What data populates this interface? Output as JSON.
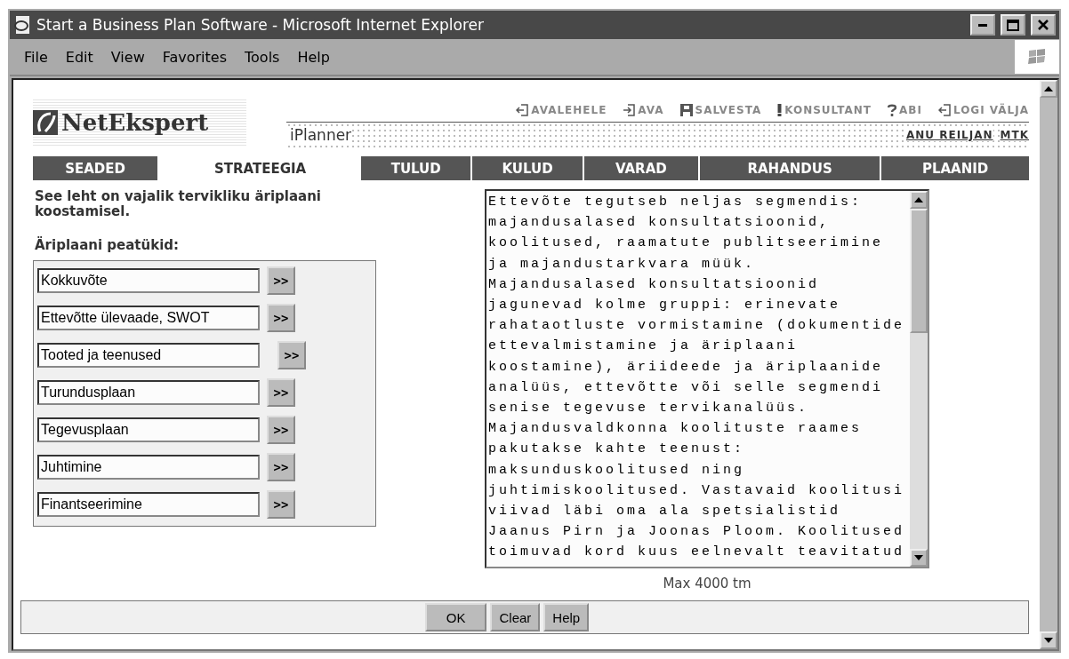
{
  "window": {
    "title": "Start a Business Plan Software - Microsoft Internet Explorer"
  },
  "menu": [
    "File",
    "Edit",
    "View",
    "Favorites",
    "Tools",
    "Help"
  ],
  "logo": "NetEkspert",
  "app_name": "iPlanner",
  "top_links": [
    {
      "kind": "home",
      "label": "AVALEHELE"
    },
    {
      "kind": "open",
      "label": "AVA"
    },
    {
      "kind": "save",
      "label": "SALVESTA"
    },
    {
      "kind": "alert",
      "label": "KONSULTANT"
    },
    {
      "kind": "help",
      "label": "ABI"
    },
    {
      "kind": "logout",
      "label": "LOGI VÄLJA"
    }
  ],
  "user_links": [
    "ANU REILJAN",
    "MTK"
  ],
  "tabs": [
    {
      "label": "SEADED",
      "selected": false
    },
    {
      "label": "STRATEEGIA",
      "selected": true
    },
    {
      "label": "TULUD",
      "selected": false
    },
    {
      "label": "KULUD",
      "selected": false
    },
    {
      "label": "VARAD",
      "selected": false
    },
    {
      "label": "RAHANDUS",
      "selected": false
    },
    {
      "label": "PLAANID",
      "selected": false
    }
  ],
  "intro": "See leht on vajalik tervikliku äriplaani koostamisel.",
  "chapters_heading": "Äriplaani peatükid:",
  "chapters": [
    {
      "value": "Kokkuvõte",
      "button": ">>"
    },
    {
      "value": "Ettevõtte ülevaade, SWOT",
      "button": ">>"
    },
    {
      "value": "Tooted ja teenused",
      "button": ">>"
    },
    {
      "value": "Turundusplaan",
      "button": ">>"
    },
    {
      "value": "Tegevusplaan",
      "button": ">>"
    },
    {
      "value": "Juhtimine",
      "button": ">>"
    },
    {
      "value": "Finantseerimine",
      "button": ">>"
    }
  ],
  "text_area": "Ettevõte tegutseb neljas segmendis: majandusalased konsultatsioonid, koolitused, raamatute publitseerimine ja majandustarkvara müük. Majandusalased konsultatsioonid jagunevad kolme gruppi: erinevate rahataotluste vormistamine (dokumentide ettevalmistamine ja äriplaani koostamine), äriideede ja äriplaanide analüüs, ettevõtte või selle segmendi senise tegevuse tervikanalüüs. Majandusvaldkonna koolituste raames pakutakse kahte teenust: maksunduskoolitused ning juhtimiskoolitused. Vastavaid koolitusi viivad läbi oma ala spetsialistid Jaanus Pirn ja Joonas Ploom. Koolitused toimuvad kord kuus eelnevalt teavitatud",
  "limit_note": "Max 4000 tm",
  "buttons": [
    "OK",
    "Clear",
    "Help"
  ]
}
